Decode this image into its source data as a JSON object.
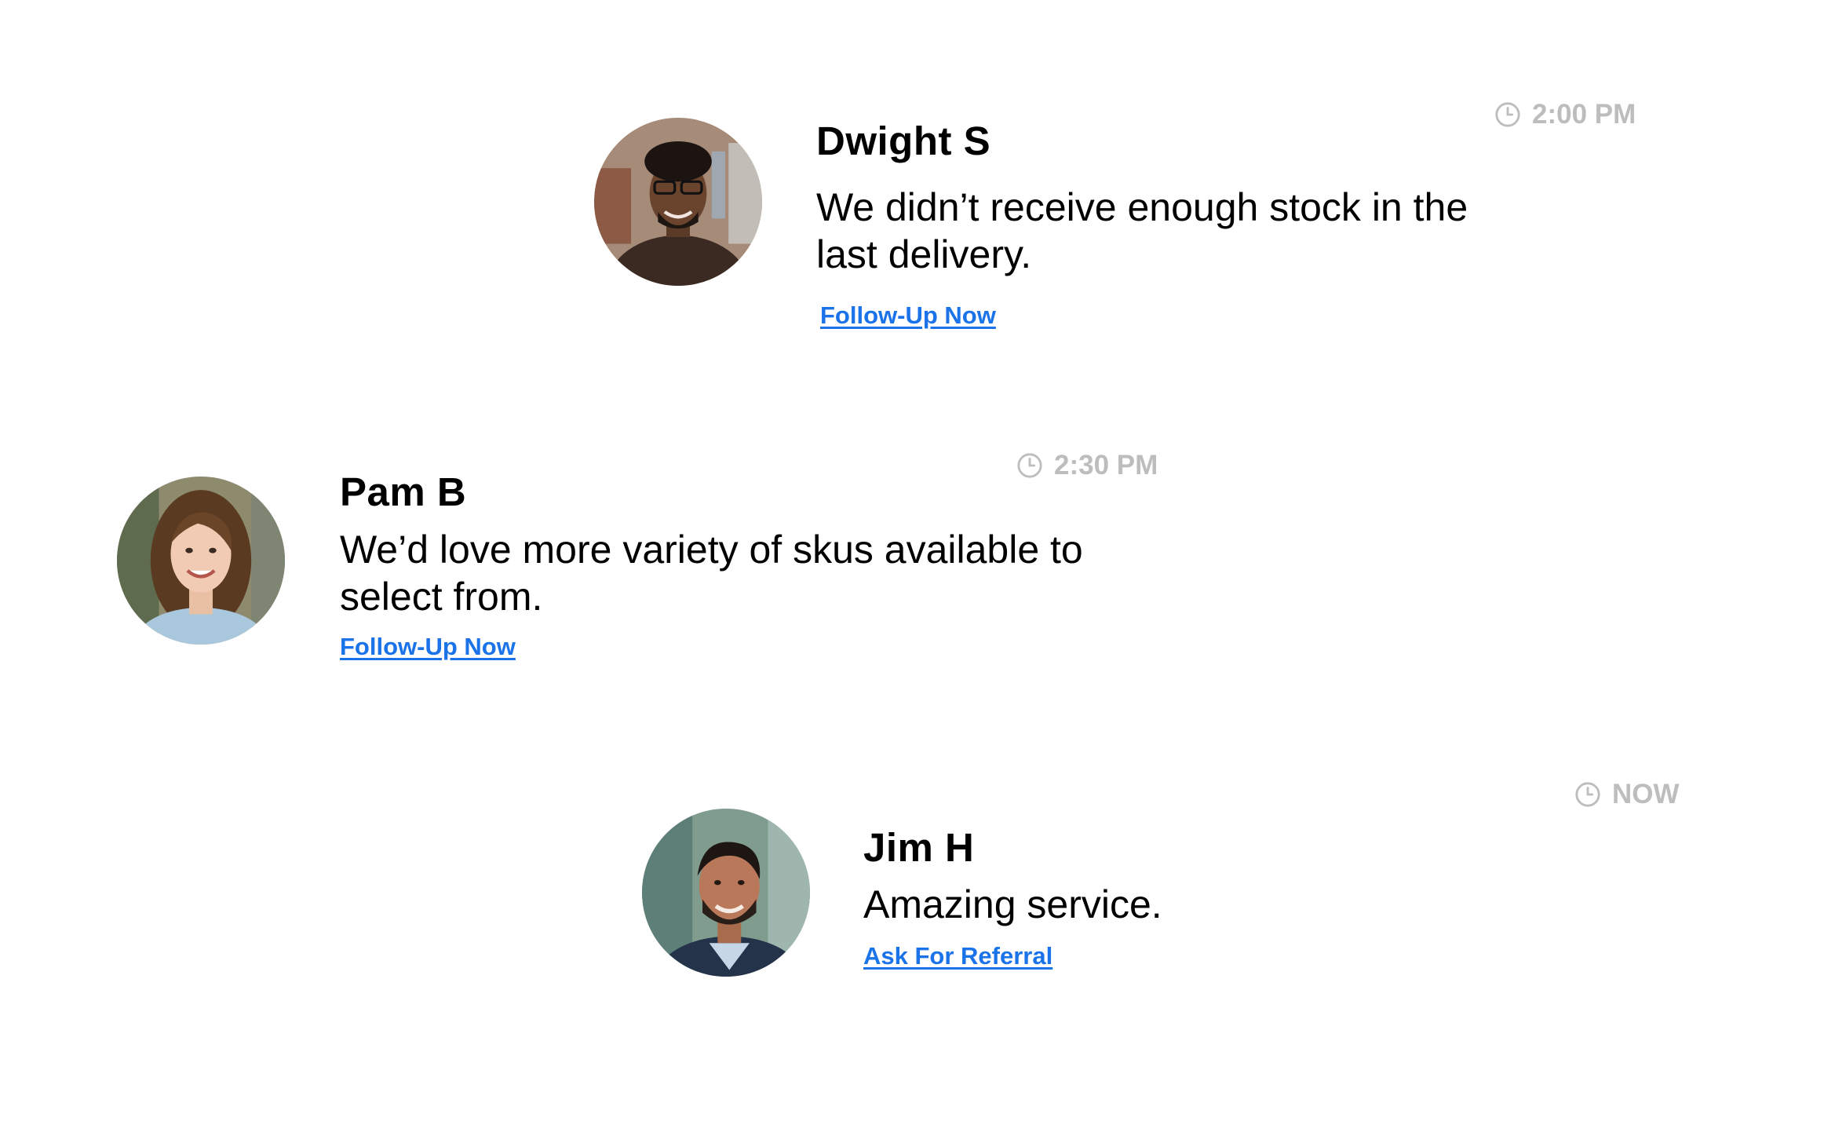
{
  "feed": {
    "items": [
      {
        "name": "Dwight S",
        "message": "We didn’t receive enough stock in the last delivery.",
        "action_label": "Follow-Up Now ",
        "time": "2:00 PM",
        "avatar_icon": "person-avatar"
      },
      {
        "name": "Pam B",
        "message": "We’d love more variety of skus available to select from.",
        "action_label": "Follow-Up Now ",
        "time": "2:30 PM",
        "avatar_icon": "person-avatar"
      },
      {
        "name": "Jim H",
        "message": "Amazing service.",
        "action_label": "Ask For Referral",
        "time": "NOW",
        "avatar_icon": "person-avatar"
      }
    ]
  },
  "colors": {
    "link": "#1a73e8",
    "timestamp": "#bdbdbd",
    "text": "#000000"
  }
}
